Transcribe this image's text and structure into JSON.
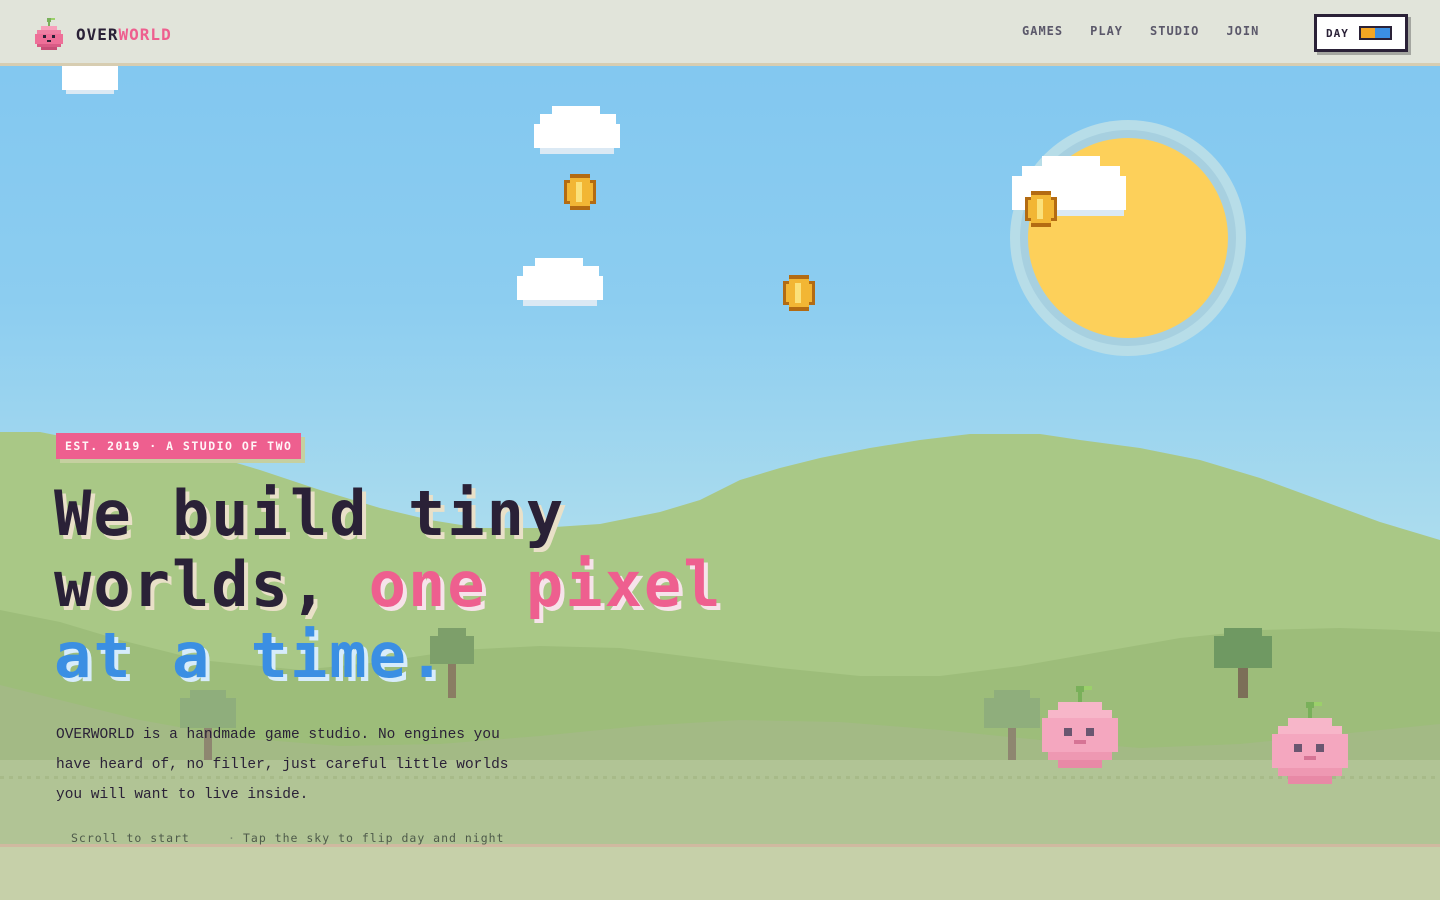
{
  "header": {
    "logo_prefix": "OVER",
    "logo_suffix": "WORLD",
    "nav": [
      "GAMES",
      "PLAY",
      "STUDIO",
      "JOIN"
    ],
    "toggle_label": "DAY"
  },
  "hero": {
    "badge": "EST. 2019 · A STUDIO OF TWO",
    "headline_line1": "We build tiny",
    "headline_line2a": "worlds,",
    "headline_line2b": "one pixel",
    "headline_line3": "at a time.",
    "description": "OVERWORLD is a handmade game studio. No engines you have heard of, no filler, just careful little worlds you will want to live inside.",
    "hint_scroll": "Scroll to start",
    "hint_tap": "Tap the sky to flip day and night"
  },
  "icons": {
    "logo": "pink-blob-icon",
    "coin": "coin-icon",
    "sun": "sun-icon",
    "cloud": "cloud-icon",
    "critter": "pink-blob-critter-icon",
    "tree": "tree-icon"
  },
  "colors": {
    "accent_pink": "#ee5f8f",
    "accent_blue": "#3b8fe3",
    "ink": "#2a2137",
    "sun": "#fdd05a",
    "sky": "#82c8f0",
    "hill": "#a9c886"
  }
}
